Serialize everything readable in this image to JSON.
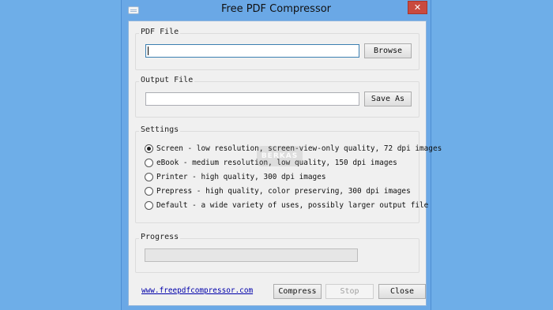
{
  "window": {
    "title": "Free PDF Compressor",
    "close_glyph": "✕",
    "app_icon": "window-icon"
  },
  "pdf_file": {
    "label": "PDF File",
    "value": "",
    "browse_label": "Browse"
  },
  "output_file": {
    "label": "Output File",
    "value": "",
    "save_as_label": "Save As"
  },
  "settings": {
    "label": "Settings",
    "options": [
      {
        "label": "Screen - low resolution, screen-view-only quality, 72 dpi images",
        "checked": true
      },
      {
        "label": "eBook - medium resolution, low quality, 150 dpi images",
        "checked": false
      },
      {
        "label": "Printer - high quality, 300 dpi images",
        "checked": false
      },
      {
        "label": "Prepress - high quality, color preserving, 300 dpi images",
        "checked": false
      },
      {
        "label": "Default - a wide variety of uses, possibly larger output file",
        "checked": false
      }
    ]
  },
  "progress": {
    "label": "Progress",
    "value": 0
  },
  "footer": {
    "link": "www.freepdfcompressor.com",
    "compress_label": "Compress",
    "stop_label": "Stop",
    "close_label": "Close"
  },
  "watermark": "BERKAS"
}
